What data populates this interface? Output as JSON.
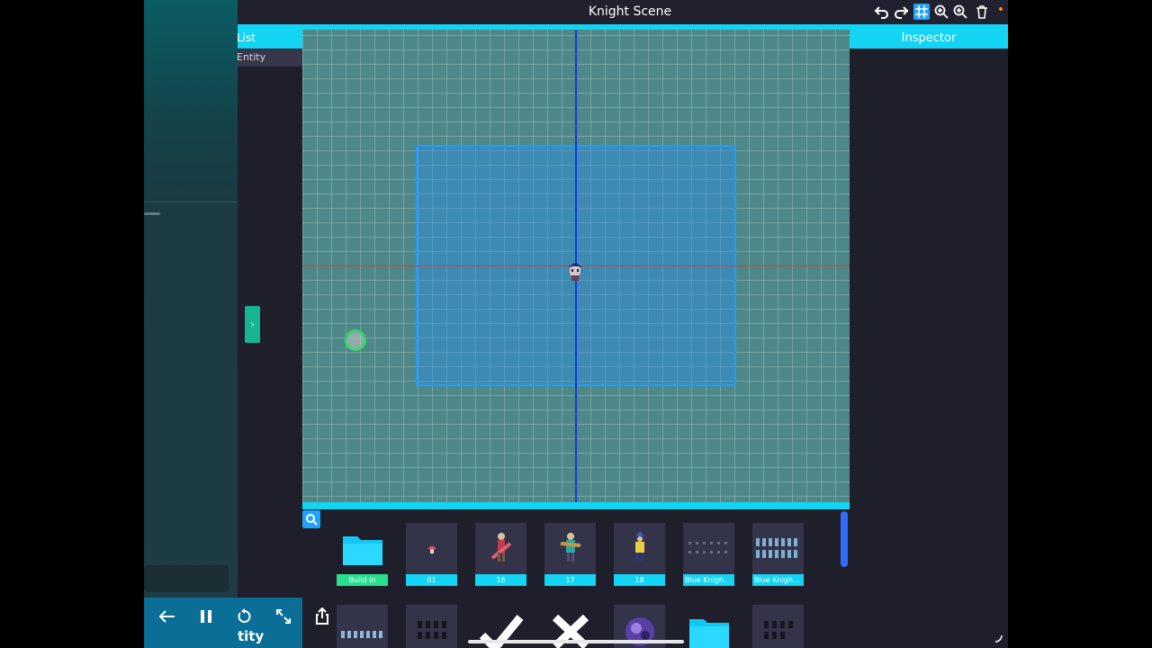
{
  "app": {
    "title": "Knight Scene",
    "entity_list_label": "List",
    "entity_row_label": "Entity",
    "inspector_label": "Inspector",
    "footer_partial_text": "tity"
  },
  "toolbar": {
    "icons": [
      "undo-icon",
      "redo-icon",
      "grid-icon",
      "zoom-in-icon",
      "zoom-out-icon",
      "trash-icon"
    ]
  },
  "assets": {
    "row1": [
      {
        "label": "Build In",
        "icon": "folder-icon"
      },
      {
        "label": "01",
        "icon": "sprite-mushroom"
      },
      {
        "label": "16",
        "icon": "sprite-knight-red"
      },
      {
        "label": "17",
        "icon": "sprite-knight-teal"
      },
      {
        "label": "18",
        "icon": "sprite-knight-yellow"
      },
      {
        "label": "Blue Knight...",
        "icon": "sprite-sheet"
      },
      {
        "label": "Blue Knight...",
        "icon": "sprite-sheet"
      }
    ],
    "row2": [
      {
        "icon": "sprite-sheet"
      },
      {
        "icon": "sprite-sheet-dark"
      },
      {
        "icon": "checkmark-icon"
      },
      {
        "icon": "cross-icon"
      },
      {
        "icon": "sprite-purple"
      },
      {
        "icon": "folder-icon"
      },
      {
        "icon": "sprite-sheet-dark"
      }
    ]
  },
  "colors": {
    "accent": "#13d4f2",
    "panel_bg": "#1f1e2b",
    "viewport_bg": "#4e8888",
    "camera_rect": "#1e9dff",
    "build_in_label": "#26e08f"
  },
  "controls": [
    "back-arrow-icon",
    "pause-icon",
    "restart-icon",
    "fullscreen-icon",
    "share-icon"
  ]
}
